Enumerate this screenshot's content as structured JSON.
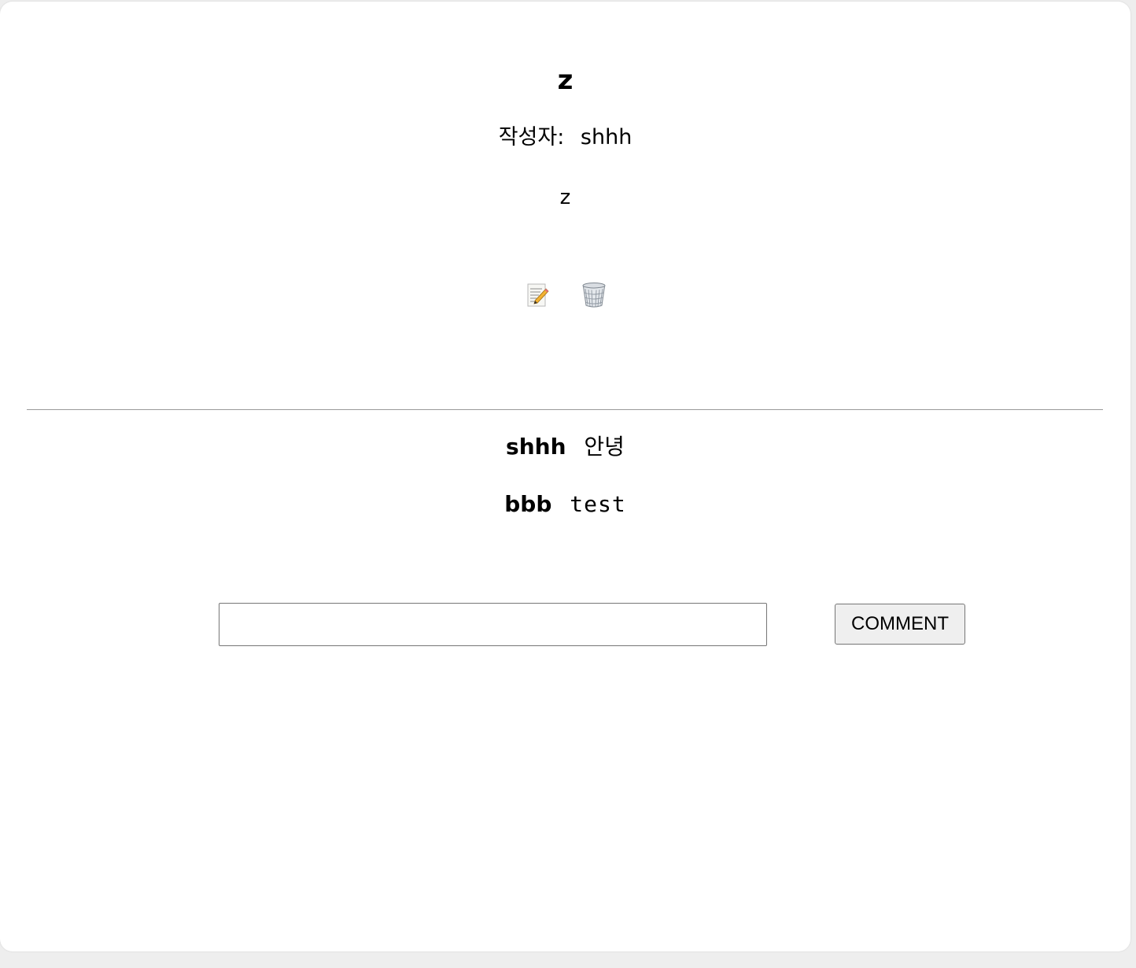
{
  "post": {
    "title": "z",
    "author_label": "작성자:",
    "author": "shhh",
    "content": "z"
  },
  "actions": {
    "edit_icon": "memo-pencil-icon",
    "delete_icon": "wastebasket-icon"
  },
  "comments": [
    {
      "author": "shhh",
      "text": "안녕"
    },
    {
      "author": "bbb",
      "text": "test"
    }
  ],
  "comment_form": {
    "input_value": "",
    "input_placeholder": "",
    "submit_label": "COMMENT"
  },
  "colors": {
    "page_background": "#eeeeee",
    "card_background": "#ffffff",
    "divider": "#9a9a9a",
    "button_background": "#efefef"
  }
}
